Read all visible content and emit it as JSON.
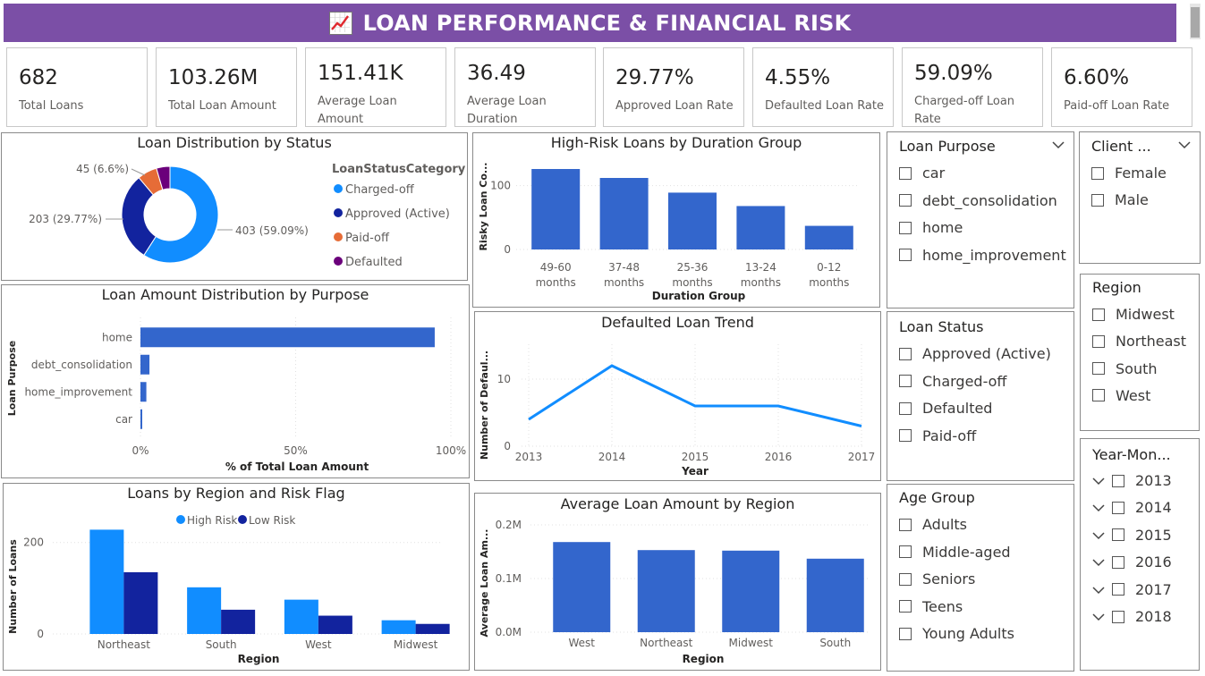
{
  "header": {
    "title": "LOAN PERFORMANCE & FINANCIAL RISK",
    "icon": "chart-increasing-icon",
    "accent_color": "#7b4fa6"
  },
  "kpis": [
    {
      "value": "682",
      "label_lines": [
        "Total Loans"
      ]
    },
    {
      "value": "103.26M",
      "label_lines": [
        "Total Loan Amount"
      ]
    },
    {
      "value": "151.41K",
      "label_lines": [
        "Average Loan",
        "Amount"
      ]
    },
    {
      "value": "36.49",
      "label_lines": [
        "Average Loan",
        "Duration"
      ]
    },
    {
      "value": "29.77%",
      "label_lines": [
        "Approved Loan Rate"
      ]
    },
    {
      "value": "4.55%",
      "label_lines": [
        "Defaulted Loan Rate"
      ]
    },
    {
      "value": "59.09%",
      "label_lines": [
        "Charged-off Loan",
        "Rate"
      ]
    },
    {
      "value": "6.60%",
      "label_lines": [
        "Paid-off Loan Rate"
      ]
    }
  ],
  "chart_data": [
    {
      "id": "status",
      "type": "pie",
      "title": "Loan Distribution by Status",
      "legend_title": "LoanStatusCategory",
      "legend_position": "right",
      "slices": [
        {
          "name": "Charged-off",
          "value": 403,
          "pct": 59.09,
          "color": "#118dff",
          "label": "403 (59.09%)"
        },
        {
          "name": "Approved (Active)",
          "value": 203,
          "pct": 29.77,
          "color": "#12239e",
          "label": "203 (29.77%)"
        },
        {
          "name": "Paid-off",
          "value": 45,
          "pct": 6.6,
          "color": "#e66c37",
          "label": "45 (6.6%)"
        },
        {
          "name": "Defaulted",
          "value": 31,
          "pct": 4.55,
          "color": "#6b007b",
          "label": ""
        }
      ]
    },
    {
      "id": "highrisk",
      "type": "bar",
      "title": "High-Risk Loans by Duration Group",
      "xlabel": "Duration Group",
      "ylabel": "Risky Loan Co...",
      "categories": [
        [
          "49-60",
          "months"
        ],
        [
          "37-48",
          "months"
        ],
        [
          "25-36",
          "months"
        ],
        [
          "13-24",
          "months"
        ],
        [
          "0-12",
          "months"
        ]
      ],
      "values": [
        126,
        112,
        89,
        68,
        37
      ],
      "yticks": [
        "0",
        "100"
      ],
      "ylim": [
        0,
        140
      ],
      "color": "#3366cc"
    },
    {
      "id": "purpose",
      "type": "bar",
      "orientation": "horizontal",
      "title": "Loan Amount Distribution by Purpose",
      "xlabel": "% of Total Loan Amount",
      "ylabel": "Loan Purpose",
      "categories": [
        "home",
        "debt_consolidation",
        "home_improvement",
        "car"
      ],
      "values": [
        94.8,
        2.9,
        1.9,
        0.4
      ],
      "xticks": [
        "0%",
        "50%",
        "100%"
      ],
      "xlim": [
        0,
        100
      ],
      "color": "#3366cc"
    },
    {
      "id": "defaulted",
      "type": "line",
      "title": "Defaulted Loan Trend",
      "xlabel": "Year",
      "ylabel": "Number of Defaul...",
      "x": [
        "2013",
        "2014",
        "2015",
        "2016",
        "2017"
      ],
      "values": [
        4,
        12,
        6,
        6,
        3
      ],
      "yticks": [
        "0",
        "10"
      ],
      "ylim": [
        0,
        14
      ],
      "color": "#118dff"
    },
    {
      "id": "region-risk",
      "type": "bar",
      "title": "Loans by Region and Risk Flag",
      "xlabel": "Region",
      "ylabel": "Number of Loans",
      "legend_position": "top",
      "categories": [
        "Northeast",
        "South",
        "West",
        "Midwest"
      ],
      "series": [
        {
          "name": "High Risk",
          "values": [
            228,
            102,
            75,
            30
          ],
          "color": "#118dff"
        },
        {
          "name": "Low Risk",
          "values": [
            135,
            53,
            40,
            22
          ],
          "color": "#12239e"
        }
      ],
      "yticks": [
        "0",
        "200"
      ],
      "ylim": [
        0,
        260
      ]
    },
    {
      "id": "avg-region",
      "type": "bar",
      "title": "Average Loan Amount by Region",
      "xlabel": "Region",
      "ylabel": "Average Loan Am...",
      "categories": [
        "West",
        "Northeast",
        "Midwest",
        "South"
      ],
      "values": [
        0.168,
        0.153,
        0.152,
        0.137
      ],
      "yticks": [
        "0.0M",
        "0.1M",
        "0.2M"
      ],
      "ylim": [
        0,
        0.2
      ],
      "color": "#3366cc"
    }
  ],
  "slicers": {
    "loan_purpose": {
      "title": "Loan Purpose",
      "items": [
        "car",
        "debt_consolidation",
        "home",
        "home_improvement"
      ]
    },
    "client": {
      "title": "Client ...",
      "items": [
        "Female",
        "Male"
      ]
    },
    "region": {
      "title": "Region",
      "items": [
        "Midwest",
        "Northeast",
        "South",
        "West"
      ]
    },
    "loan_status": {
      "title": "Loan Status",
      "items": [
        "Approved (Active)",
        "Charged-off",
        "Defaulted",
        "Paid-off"
      ]
    },
    "age_group": {
      "title": "Age Group",
      "items": [
        "Adults",
        "Middle-aged",
        "Seniors",
        "Teens",
        "Young Adults"
      ]
    },
    "year_month": {
      "title": "Year-Mon...",
      "items": [
        "2013",
        "2014",
        "2015",
        "2016",
        "2017",
        "2018"
      ]
    }
  }
}
